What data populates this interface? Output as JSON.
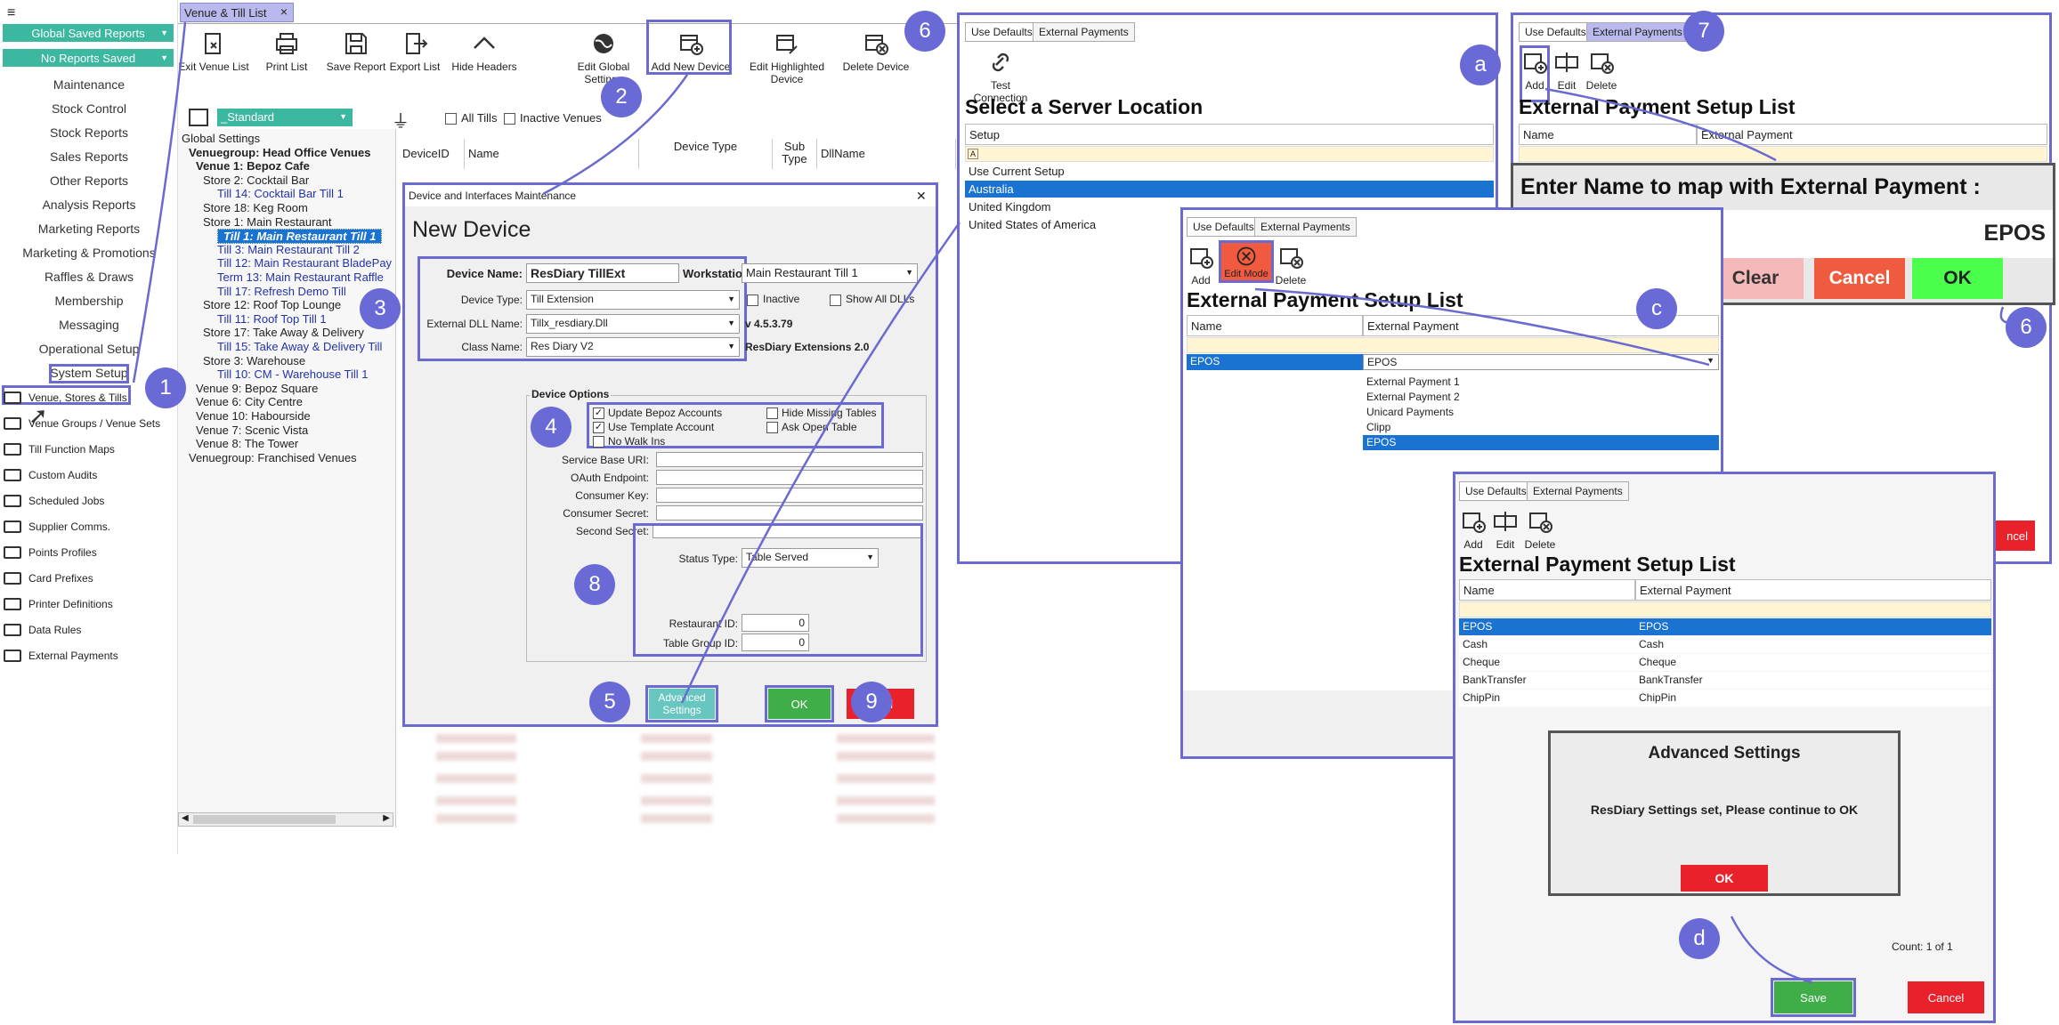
{
  "left_menu": {
    "top_button1": "Global Saved Reports",
    "top_button2": "No Reports Saved",
    "items": [
      "Maintenance",
      "Stock Control",
      "Stock Reports",
      "Sales Reports",
      "Other Reports",
      "Analysis Reports",
      "Marketing Reports",
      "Marketing & Promotions",
      "Raffles & Draws",
      "Membership",
      "Messaging",
      "Operational Setup",
      "System Setup"
    ],
    "icon_items": [
      "Venue, Stores & Tills",
      "Venue Groups / Venue Sets",
      "Till Function Maps",
      "Custom Audits",
      "Scheduled Jobs",
      "Supplier Comms.",
      "Points Profiles",
      "Card Prefixes",
      "Printer Definitions",
      "Data Rules",
      "External Payments"
    ]
  },
  "doc_tab": {
    "label": "Venue & Till List",
    "close": "×"
  },
  "toolbar": [
    "Exit Venue List",
    "Print List",
    "Save Report",
    "Export List",
    "Hide Headers",
    "Edit Global Settings",
    "Add New Device",
    "Edit Highlighted Device",
    "Delete Device"
  ],
  "filters": {
    "layout": "_Standard",
    "all_tills": "All Tills",
    "inactive_venues": "Inactive Venues"
  },
  "grid_headers": [
    "DeviceID",
    "Name",
    "Device Type",
    "Sub Type",
    "DllName"
  ],
  "tree": [
    "Global Settings",
    "Venuegroup: Head Office Venues",
    "Venue 1: Bepoz Cafe",
    "Store 2: Cocktail Bar",
    "Till 14: Cocktail Bar Till 1",
    "Store 18: Keg Room",
    "Store 1: Main Restaurant",
    "Till 1: Main Restaurant Till 1",
    "Till 3: Main Restaurant Till 2",
    "Till 12: Main Restaurant BladePay",
    "Term 13: Main Restaurant Raffle",
    "Till 17: Refresh Demo Till",
    "Store 12: Roof Top Lounge",
    "Till 11: Roof Top Till 1",
    "Store 17: Take Away & Delivery",
    "Till 15: Take Away & Delivery Till",
    "Store 3: Warehouse",
    "Till 10: CM - Warehouse Till 1",
    "Venue 9: Bepoz Square",
    "Venue 6: City Centre",
    "Venue 10: Habourside",
    "Venue 7: Scenic Vista",
    "Venue 8: The Tower",
    "Venuegroup: Franchised Venues"
  ],
  "device_dialog": {
    "window_title": "Device and Interfaces Maintenance",
    "close": "✕",
    "heading": "New Device",
    "device_name_label": "Device Name:",
    "device_name": "ResDiary TillExt",
    "workstation_label": "Workstation:",
    "workstation": "Main Restaurant Till 1",
    "device_type_label": "Device Type:",
    "device_type": "Till Extension",
    "inactive": "Inactive",
    "show_all_dlls": "Show All DLLs",
    "dll_label": "External DLL Name:",
    "dll": "Tillx_resdiary.Dll",
    "version": "v 4.5.3.79",
    "class_label": "Class Name:",
    "class": "Res Diary V2",
    "ext_name": "ResDiary Extensions 2.0",
    "options_title": "Device Options",
    "opt1": "Update Bepoz Accounts",
    "opt2": "Use Template Account",
    "opt3": "No Walk Ins",
    "opt4": "Hide Missing Tables",
    "opt5": "Ask Open Table",
    "fields": [
      "Service Base URI:",
      "OAuth Endpoint:",
      "Consumer Key:",
      "Consumer Secret:",
      "Second Secret:"
    ],
    "status_label": "Status Type:",
    "status": "Table Served",
    "restaurant_label": "Restaurant ID:",
    "restaurant": "0",
    "table_group_label": "Table Group ID:",
    "table_group": "0",
    "advanced": "Advanced Settings",
    "ok": "OK",
    "cancel": "l"
  },
  "server_panel": {
    "tab1": "Use Defaults",
    "tab2": "External Payments",
    "test": "Test Connection",
    "heading": "Select a Server Location",
    "col": "Setup",
    "rows": [
      "Use Current Setup",
      "Australia",
      "United Kingdom",
      "United States of America"
    ]
  },
  "ext_panel_top": {
    "tab1": "Use Defaults",
    "tab2": "External Payments",
    "add": "Add",
    "edit": "Edit",
    "delete": "Delete",
    "heading": "External Payment Setup List",
    "col1": "Name",
    "col2": "External Payment",
    "prompt": "Enter Name to map with External Payment :",
    "value": "EPOS",
    "clear": "Clear",
    "cancel": "Cancel",
    "ok": "OK",
    "cancel_bg": "ncel"
  },
  "ext_panel_mid": {
    "tab1": "Use Defaults",
    "tab2": "External Payments",
    "add": "Add",
    "edit": "Edit Mode",
    "delete": "Delete",
    "heading": "External Payment Setup List",
    "col1": "Name",
    "col2": "External Payment",
    "row_name": "EPOS",
    "row_val": "EPOS",
    "options": [
      "External Payment 1",
      "External Payment 2",
      "Unicard Payments",
      "Clipp",
      "EPOS"
    ]
  },
  "ext_panel_bot": {
    "tab1": "Use Defaults",
    "tab2": "External Payments",
    "add": "Add",
    "edit": "Edit",
    "delete": "Delete",
    "heading": "External Payment Setup List",
    "col1": "Name",
    "col2": "External Payment",
    "rows": [
      [
        "EPOS",
        "EPOS"
      ],
      [
        "Cash",
        "Cash"
      ],
      [
        "Cheque",
        "Cheque"
      ],
      [
        "BankTransfer",
        "BankTransfer"
      ],
      [
        "ChipPin",
        "ChipPin"
      ]
    ],
    "adv_title": "Advanced Settings",
    "adv_msg": "ResDiary Settings set, Please continue to OK",
    "adv_ok": "OK",
    "count": "Count: 1 of 1",
    "save": "Save",
    "cancel": "Cancel"
  },
  "badges": [
    "1",
    "2",
    "3",
    "4",
    "5",
    "6",
    "7",
    "8",
    "9",
    "a",
    "c",
    "6",
    "d"
  ],
  "colors": {
    "accent": "#6a6ad6",
    "green": "#3fae49",
    "red": "#e8212b",
    "selected": "#1a73d1"
  }
}
